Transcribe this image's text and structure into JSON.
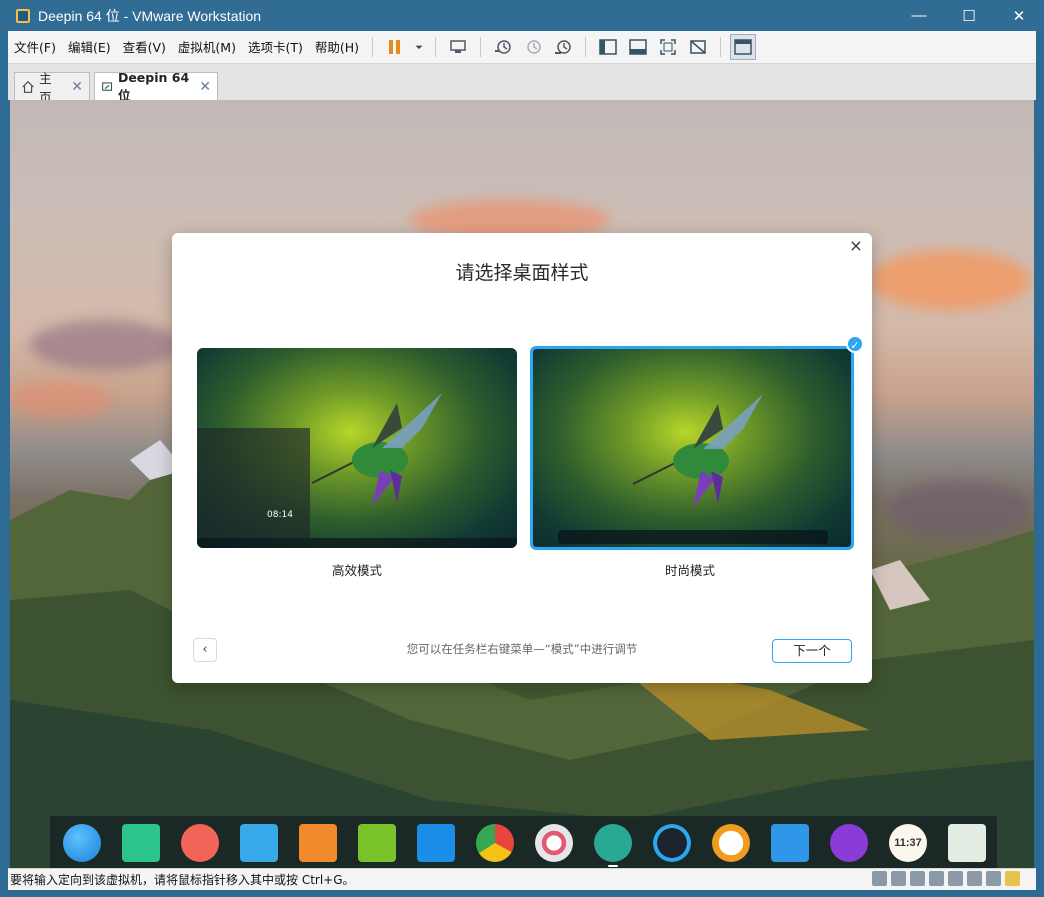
{
  "window": {
    "title": "Deepin 64 位 - VMware Workstation",
    "controls": {
      "minimize": "—",
      "maximize": "☐",
      "close": "✕"
    }
  },
  "menubar": {
    "items": [
      "文件(F)",
      "编辑(E)",
      "查看(V)",
      "虚拟机(M)",
      "选项卡(T)",
      "帮助(H)"
    ]
  },
  "tabs": [
    {
      "label": "主页",
      "close": "✕",
      "icon": "home-icon"
    },
    {
      "label": "Deepin 64 位",
      "close": "✕",
      "icon": "vm-icon",
      "active": true
    }
  ],
  "dialog": {
    "title": "请选择桌面样式",
    "close": "×",
    "options": [
      {
        "label": "高效模式",
        "selected": false
      },
      {
        "label": "时尚模式",
        "selected": true
      }
    ],
    "check": "✓",
    "preview_time": "08:14",
    "back": "‹",
    "hint": "您可以在任务栏右键菜单—“模式”中进行调节",
    "next": "下一个"
  },
  "dock": {
    "apps": [
      "launcher-icon",
      "file-manager-icon",
      "screen-recorder-icon",
      "archive-icon",
      "app-store-icon",
      "music-icon",
      "video-icon",
      "chrome-icon",
      "settings-icon",
      "deepin-remote-icon",
      "keyboard-icon",
      "browser-icon",
      "screenshot-icon",
      "power-icon",
      "clock-icon",
      "trash-icon"
    ],
    "clock_label": "11:37"
  },
  "statusbar": {
    "text": "要将输入定向到该虚拟机，请将鼠标指针移入其中或按 Ctrl+G。"
  },
  "colors": {
    "accent": "#2ca7f8",
    "titlebar": "#306c94"
  }
}
